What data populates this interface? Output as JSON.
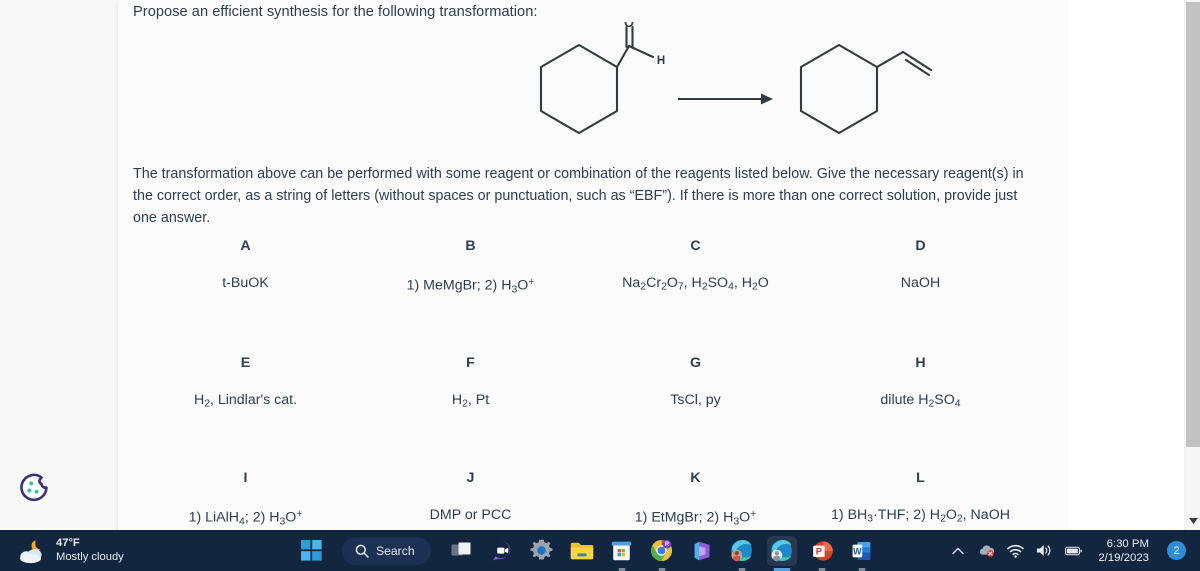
{
  "document": {
    "question_title": "Propose an efficient synthesis for the following transformation:",
    "instructions": "The transformation above can be performed with some reagent or combination of the reagents listed below. Give the necessary reagent(s) in the correct order, as a string of letters (without spaces or punctuation, such as “EBF”). If there is more than one correct solution, provide just one answer.",
    "scheme": {
      "reactant_name": "cyclohexanecarbaldehyde",
      "product_name": "vinylcyclohexane",
      "reactant_label_o": "O",
      "reactant_label_h": "H",
      "arrow": "reaction-arrow"
    },
    "reagents": [
      [
        {
          "letter": "A",
          "text": "t-BuOK"
        },
        {
          "letter": "B",
          "text": "1) MeMgBr; 2) H<sub>3</sub>O<sup>+</sup>"
        },
        {
          "letter": "C",
          "text": "Na<sub>2</sub>Cr<sub>2</sub>O<sub>7</sub>, H<sub>2</sub>SO<sub>4</sub>, H<sub>2</sub>O"
        },
        {
          "letter": "D",
          "text": "NaOH"
        }
      ],
      [
        {
          "letter": "E",
          "text": "H<sub>2</sub>, Lindlar's cat."
        },
        {
          "letter": "F",
          "text": "H<sub>2</sub>, Pt"
        },
        {
          "letter": "G",
          "text": "TsCl, py"
        },
        {
          "letter": "H",
          "text": "dilute H<sub>2</sub>SO<sub>4</sub>"
        }
      ],
      [
        {
          "letter": "I",
          "text": "1) LiAlH<sub>4</sub>; 2) H<sub>3</sub>O<sup>+</sup>"
        },
        {
          "letter": "J",
          "text": "DMP or PCC"
        },
        {
          "letter": "K",
          "text": "1) EtMgBr; 2) H<sub>3</sub>O<sup>+</sup>"
        },
        {
          "letter": "L",
          "text": "1) BH<sub>3</sub>·THF; 2) H<sub>2</sub>O<sub>2</sub>, NaOH"
        }
      ]
    ]
  },
  "scrollbar": {
    "position": "top"
  },
  "taskbar": {
    "weather": {
      "temperature": "47°F",
      "condition": "Mostly cloudy",
      "icon": "partly-cloudy-night-icon"
    },
    "search": {
      "label": "Search",
      "icon": "search-icon"
    },
    "items": [
      {
        "name": "start-button",
        "icon": "windows-logo-icon"
      },
      {
        "name": "task-view-button",
        "icon": "task-view-icon"
      },
      {
        "name": "chat-button",
        "icon": "chat-icon"
      },
      {
        "name": "settings-button",
        "icon": "gear-icon"
      },
      {
        "name": "file-explorer-button",
        "icon": "folder-icon"
      },
      {
        "name": "microsoft-store-button",
        "icon": "store-icon"
      },
      {
        "name": "chrome-button",
        "icon": "chrome-icon"
      },
      {
        "name": "office-button",
        "icon": "office-icon"
      },
      {
        "name": "edge-button",
        "icon": "edge-icon"
      },
      {
        "name": "edge-active-button",
        "icon": "edge-icon"
      },
      {
        "name": "powerpoint-button",
        "icon": "powerpoint-icon"
      },
      {
        "name": "word-button",
        "icon": "word-icon"
      }
    ],
    "tray": {
      "overflow_icon": "chevron-up-icon",
      "onedrive_icon": "onedrive-error-icon",
      "wifi_icon": "wifi-icon",
      "volume_icon": "speaker-icon",
      "battery_icon": "battery-icon",
      "time": "6:30 PM",
      "date": "2/19/2023",
      "notification_count": "2"
    }
  },
  "cookie_widget": {
    "icon": "cookie-icon"
  },
  "colors": {
    "taskbar_bg": "#12263f",
    "text": "#2d3e50",
    "accent_blue": "#2b8fd6",
    "cookie_purple": "#3d2f78",
    "cookie_green": "#3fc49a"
  }
}
